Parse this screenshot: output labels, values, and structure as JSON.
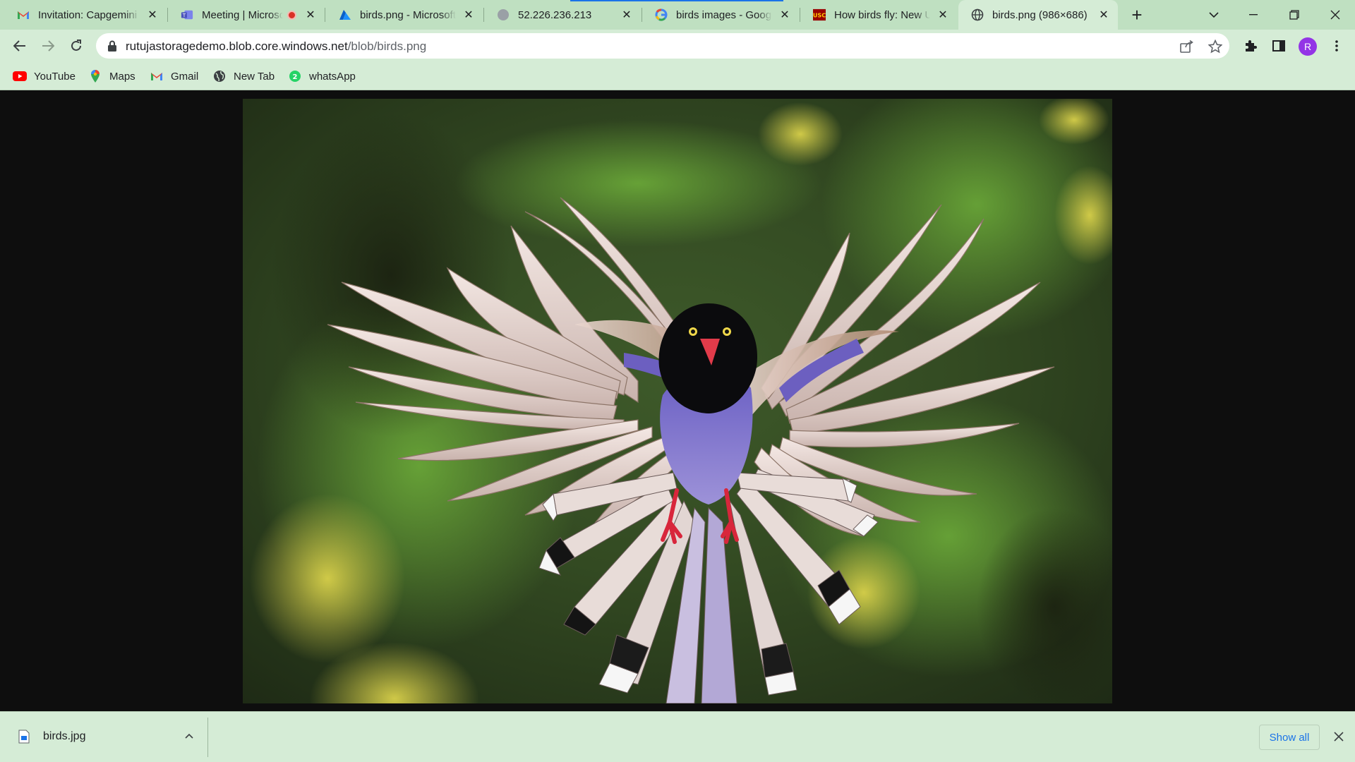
{
  "tabs": [
    {
      "title": "Invitation: Capgemini",
      "icon": "gmail-icon"
    },
    {
      "title": "Meeting | Microsoft Teams",
      "icon": "teams-icon",
      "recording": true
    },
    {
      "title": "birds.png - Microsoft Azure",
      "icon": "azure-icon"
    },
    {
      "title": "52.226.236.213",
      "icon": "globe-icon"
    },
    {
      "title": "birds images - Google Search",
      "icon": "google-icon"
    },
    {
      "title": "How birds fly: New USC",
      "icon": "usc-icon"
    },
    {
      "title": "birds.png (986×686)",
      "icon": "globe-icon",
      "active": true
    }
  ],
  "address_bar": {
    "host": "rutujastoragedemo.blob.core.windows.net",
    "path": "/blob/birds.png"
  },
  "bookmarks": [
    {
      "label": "YouTube",
      "icon": "youtube-icon"
    },
    {
      "label": "Maps",
      "icon": "maps-icon"
    },
    {
      "label": "Gmail",
      "icon": "gmail-icon"
    },
    {
      "label": "New Tab",
      "icon": "globe-icon"
    },
    {
      "label": "whatsApp",
      "icon": "whatsapp-icon"
    }
  ],
  "profile": {
    "initial": "R"
  },
  "content": {
    "image_alt": "Blue magpie in flight with spread wings"
  },
  "downloads": {
    "file_name": "birds.jpg",
    "show_all_label": "Show all"
  },
  "colors": {
    "chrome_frame": "#bfe0c1",
    "toolbar": "#d5ecd6",
    "viewer_background": "#0e0e0e",
    "link_blue": "#1a73e8"
  }
}
